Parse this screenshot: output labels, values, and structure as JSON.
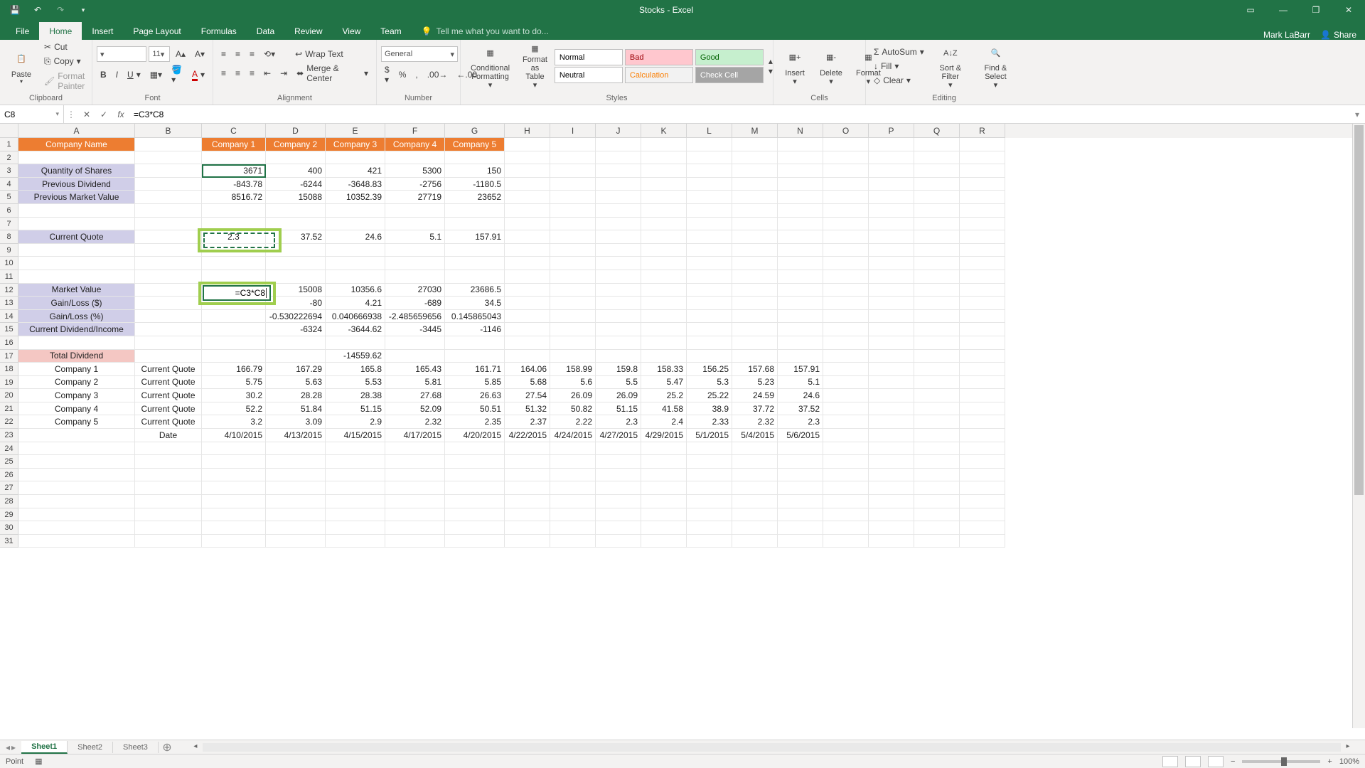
{
  "app": {
    "title": "Stocks - Excel",
    "user": "Mark LaBarr"
  },
  "qat": {
    "save": "💾",
    "undo": "↶",
    "redo": "↷"
  },
  "tabs": [
    "File",
    "Home",
    "Insert",
    "Page Layout",
    "Formulas",
    "Data",
    "Review",
    "View",
    "Team"
  ],
  "active_tab": "Home",
  "tellme": "Tell me what you want to do...",
  "share": "Share",
  "ribbon": {
    "clipboard": {
      "paste": "Paste",
      "cut": "Cut",
      "copy": "Copy",
      "fp": "Format Painter",
      "label": "Clipboard"
    },
    "font": {
      "size": "11",
      "label": "Font",
      "bold": "B",
      "italic": "I",
      "underline": "U"
    },
    "alignment": {
      "wrap": "Wrap Text",
      "merge": "Merge & Center",
      "label": "Alignment"
    },
    "number": {
      "format": "General",
      "label": "Number"
    },
    "styles": {
      "cond": "Conditional Formatting",
      "fat": "Format as Table",
      "normal": "Normal",
      "bad": "Bad",
      "good": "Good",
      "neutral": "Neutral",
      "calc": "Calculation",
      "check": "Check Cell",
      "label": "Styles"
    },
    "cells": {
      "insert": "Insert",
      "delete": "Delete",
      "format": "Format",
      "label": "Cells"
    },
    "editing": {
      "autosum": "AutoSum",
      "fill": "Fill",
      "clear": "Clear",
      "sort": "Sort & Filter",
      "find": "Find & Select",
      "label": "Editing"
    }
  },
  "namebox": "C8",
  "formula": "=C3*C8",
  "editing_formula": "=C3*C8",
  "columns": [
    "A",
    "B",
    "C",
    "D",
    "E",
    "F",
    "G",
    "H",
    "I",
    "J",
    "K",
    "L",
    "M",
    "N",
    "O",
    "P",
    "Q",
    "R"
  ],
  "rows": {
    "1": {
      "A": "Company Name",
      "C": "Company 1",
      "D": "Company 2",
      "E": "Company 3",
      "F": "Company 4",
      "G": "Company 5"
    },
    "3": {
      "A": "Quantity of Shares",
      "C": "3671",
      "D": "400",
      "E": "421",
      "F": "5300",
      "G": "150"
    },
    "4": {
      "A": "Previous Dividend",
      "C": "-843.78",
      "D": "-6244",
      "E": "-3648.83",
      "F": "-2756",
      "G": "-1180.5"
    },
    "5": {
      "A": "Previous Market Value",
      "C": "8516.72",
      "D": "15088",
      "E": "10352.39",
      "F": "27719",
      "G": "23652"
    },
    "8": {
      "A": "Current Quote",
      "C": "2.3",
      "D": "37.52",
      "E": "24.6",
      "F": "5.1",
      "G": "157.91"
    },
    "12": {
      "A": "Market Value",
      "C": "=C3*C8",
      "D": "15008",
      "E": "10356.6",
      "F": "27030",
      "G": "23686.5"
    },
    "13": {
      "A": "Gain/Loss ($)",
      "D": "-80",
      "E": "4.21",
      "F": "-689",
      "G": "34.5"
    },
    "14": {
      "A": "Gain/Loss (%)",
      "D": "-0.530222694",
      "E": "0.040666938",
      "F": "-2.485659656",
      "G": "0.145865043"
    },
    "15": {
      "A": "Current Dividend/Income",
      "D": "-6324",
      "E": "-3644.62",
      "F": "-3445",
      "G": "-1146"
    },
    "17": {
      "A": "Total Dividend",
      "E": "-14559.62"
    },
    "18": {
      "A": "Company 1",
      "B": "Current Quote",
      "C": "166.79",
      "D": "167.29",
      "E": "165.8",
      "F": "165.43",
      "G": "161.71",
      "H": "164.06",
      "I": "158.99",
      "J": "159.8",
      "K": "158.33",
      "L": "156.25",
      "M": "157.68",
      "N": "157.91"
    },
    "19": {
      "A": "Company 2",
      "B": "Current Quote",
      "C": "5.75",
      "D": "5.63",
      "E": "5.53",
      "F": "5.81",
      "G": "5.85",
      "H": "5.68",
      "I": "5.6",
      "J": "5.5",
      "K": "5.47",
      "L": "5.3",
      "M": "5.23",
      "N": "5.1"
    },
    "20": {
      "A": "Company 3",
      "B": "Current Quote",
      "C": "30.2",
      "D": "28.28",
      "E": "28.38",
      "F": "27.68",
      "G": "26.63",
      "H": "27.54",
      "I": "26.09",
      "J": "26.09",
      "K": "25.2",
      "L": "25.22",
      "M": "24.59",
      "N": "24.6"
    },
    "21": {
      "A": "Company 4",
      "B": "Current Quote",
      "C": "52.2",
      "D": "51.84",
      "E": "51.15",
      "F": "52.09",
      "G": "50.51",
      "H": "51.32",
      "I": "50.82",
      "J": "51.15",
      "K": "41.58",
      "L": "38.9",
      "M": "37.72",
      "N": "37.52"
    },
    "22": {
      "A": "Company 5",
      "B": "Current Quote",
      "C": "3.2",
      "D": "3.09",
      "E": "2.9",
      "F": "2.32",
      "G": "2.35",
      "H": "2.37",
      "I": "2.22",
      "J": "2.3",
      "K": "2.4",
      "L": "2.33",
      "M": "2.32",
      "N": "2.3"
    },
    "23": {
      "B": "Date",
      "C": "4/10/2015",
      "D": "4/13/2015",
      "E": "4/15/2015",
      "F": "4/17/2015",
      "G": "4/20/2015",
      "H": "4/22/2015",
      "I": "4/24/2015",
      "J": "4/27/2015",
      "K": "4/29/2015",
      "L": "5/1/2015",
      "M": "5/4/2015",
      "N": "5/6/2015"
    }
  },
  "sheets": [
    "Sheet1",
    "Sheet2",
    "Sheet3"
  ],
  "active_sheet": "Sheet1",
  "status": {
    "mode": "Point",
    "zoom": "100%"
  }
}
